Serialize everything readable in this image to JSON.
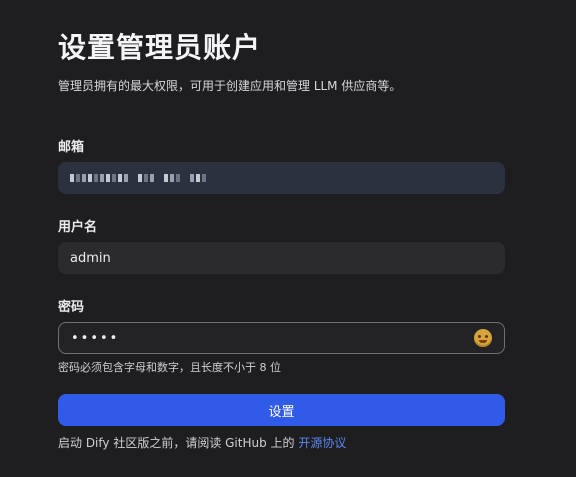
{
  "header": {
    "title": "设置管理员账户",
    "subtitle": "管理员拥有的最大权限，可用于创建应用和管理 LLM 供应商等。"
  },
  "form": {
    "email": {
      "label": "邮箱"
    },
    "username": {
      "label": "用户名",
      "value": "admin"
    },
    "password": {
      "label": "密码",
      "masked_value": "•••••",
      "hint": "密码必须包含字母和数字，且长度不小于 8 位",
      "toggle_icon": "emoji-face-icon"
    },
    "submit_label": "设置"
  },
  "footer": {
    "text": "启动 Dify 社区版之前，请阅读 GitHub 上的 ",
    "link_label": "开源协议"
  },
  "colors": {
    "background": "#1e1e20",
    "primary_button": "#2f5be8",
    "link": "#5b87f0",
    "email_field": "#2c3140",
    "input_field": "#2b2b2e"
  }
}
